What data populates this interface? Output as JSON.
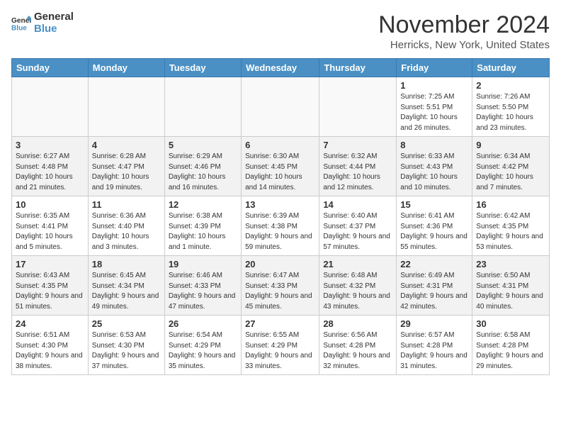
{
  "header": {
    "logo_general": "General",
    "logo_blue": "Blue",
    "month_title": "November 2024",
    "location": "Herricks, New York, United States"
  },
  "weekdays": [
    "Sunday",
    "Monday",
    "Tuesday",
    "Wednesday",
    "Thursday",
    "Friday",
    "Saturday"
  ],
  "weeks": [
    [
      {
        "day": "",
        "info": ""
      },
      {
        "day": "",
        "info": ""
      },
      {
        "day": "",
        "info": ""
      },
      {
        "day": "",
        "info": ""
      },
      {
        "day": "",
        "info": ""
      },
      {
        "day": "1",
        "info": "Sunrise: 7:25 AM\nSunset: 5:51 PM\nDaylight: 10 hours and 26 minutes."
      },
      {
        "day": "2",
        "info": "Sunrise: 7:26 AM\nSunset: 5:50 PM\nDaylight: 10 hours and 23 minutes."
      }
    ],
    [
      {
        "day": "3",
        "info": "Sunrise: 6:27 AM\nSunset: 4:48 PM\nDaylight: 10 hours and 21 minutes."
      },
      {
        "day": "4",
        "info": "Sunrise: 6:28 AM\nSunset: 4:47 PM\nDaylight: 10 hours and 19 minutes."
      },
      {
        "day": "5",
        "info": "Sunrise: 6:29 AM\nSunset: 4:46 PM\nDaylight: 10 hours and 16 minutes."
      },
      {
        "day": "6",
        "info": "Sunrise: 6:30 AM\nSunset: 4:45 PM\nDaylight: 10 hours and 14 minutes."
      },
      {
        "day": "7",
        "info": "Sunrise: 6:32 AM\nSunset: 4:44 PM\nDaylight: 10 hours and 12 minutes."
      },
      {
        "day": "8",
        "info": "Sunrise: 6:33 AM\nSunset: 4:43 PM\nDaylight: 10 hours and 10 minutes."
      },
      {
        "day": "9",
        "info": "Sunrise: 6:34 AM\nSunset: 4:42 PM\nDaylight: 10 hours and 7 minutes."
      }
    ],
    [
      {
        "day": "10",
        "info": "Sunrise: 6:35 AM\nSunset: 4:41 PM\nDaylight: 10 hours and 5 minutes."
      },
      {
        "day": "11",
        "info": "Sunrise: 6:36 AM\nSunset: 4:40 PM\nDaylight: 10 hours and 3 minutes."
      },
      {
        "day": "12",
        "info": "Sunrise: 6:38 AM\nSunset: 4:39 PM\nDaylight: 10 hours and 1 minute."
      },
      {
        "day": "13",
        "info": "Sunrise: 6:39 AM\nSunset: 4:38 PM\nDaylight: 9 hours and 59 minutes."
      },
      {
        "day": "14",
        "info": "Sunrise: 6:40 AM\nSunset: 4:37 PM\nDaylight: 9 hours and 57 minutes."
      },
      {
        "day": "15",
        "info": "Sunrise: 6:41 AM\nSunset: 4:36 PM\nDaylight: 9 hours and 55 minutes."
      },
      {
        "day": "16",
        "info": "Sunrise: 6:42 AM\nSunset: 4:35 PM\nDaylight: 9 hours and 53 minutes."
      }
    ],
    [
      {
        "day": "17",
        "info": "Sunrise: 6:43 AM\nSunset: 4:35 PM\nDaylight: 9 hours and 51 minutes."
      },
      {
        "day": "18",
        "info": "Sunrise: 6:45 AM\nSunset: 4:34 PM\nDaylight: 9 hours and 49 minutes."
      },
      {
        "day": "19",
        "info": "Sunrise: 6:46 AM\nSunset: 4:33 PM\nDaylight: 9 hours and 47 minutes."
      },
      {
        "day": "20",
        "info": "Sunrise: 6:47 AM\nSunset: 4:33 PM\nDaylight: 9 hours and 45 minutes."
      },
      {
        "day": "21",
        "info": "Sunrise: 6:48 AM\nSunset: 4:32 PM\nDaylight: 9 hours and 43 minutes."
      },
      {
        "day": "22",
        "info": "Sunrise: 6:49 AM\nSunset: 4:31 PM\nDaylight: 9 hours and 42 minutes."
      },
      {
        "day": "23",
        "info": "Sunrise: 6:50 AM\nSunset: 4:31 PM\nDaylight: 9 hours and 40 minutes."
      }
    ],
    [
      {
        "day": "24",
        "info": "Sunrise: 6:51 AM\nSunset: 4:30 PM\nDaylight: 9 hours and 38 minutes."
      },
      {
        "day": "25",
        "info": "Sunrise: 6:53 AM\nSunset: 4:30 PM\nDaylight: 9 hours and 37 minutes."
      },
      {
        "day": "26",
        "info": "Sunrise: 6:54 AM\nSunset: 4:29 PM\nDaylight: 9 hours and 35 minutes."
      },
      {
        "day": "27",
        "info": "Sunrise: 6:55 AM\nSunset: 4:29 PM\nDaylight: 9 hours and 33 minutes."
      },
      {
        "day": "28",
        "info": "Sunrise: 6:56 AM\nSunset: 4:28 PM\nDaylight: 9 hours and 32 minutes."
      },
      {
        "day": "29",
        "info": "Sunrise: 6:57 AM\nSunset: 4:28 PM\nDaylight: 9 hours and 31 minutes."
      },
      {
        "day": "30",
        "info": "Sunrise: 6:58 AM\nSunset: 4:28 PM\nDaylight: 9 hours and 29 minutes."
      }
    ]
  ]
}
